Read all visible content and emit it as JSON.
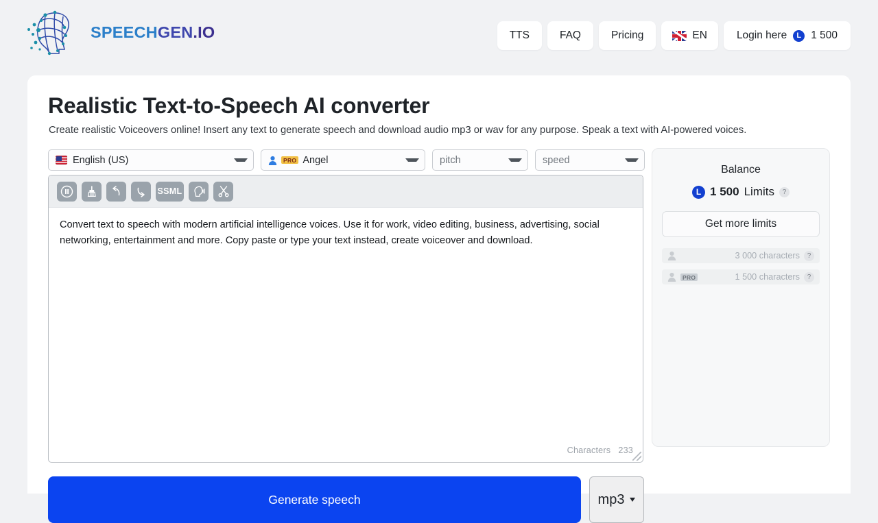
{
  "brand": {
    "name_part1": "SPEECH",
    "name_part2": "GEN",
    "name_part3": ".IO",
    "logo_icon": "network-head-logo"
  },
  "nav": {
    "tts": "TTS",
    "faq": "FAQ",
    "pricing": "Pricing",
    "lang": "EN",
    "lang_flag": "uk-flag-icon",
    "login": "Login here",
    "login_credits": "1 500",
    "credit_symbol": "L"
  },
  "hero": {
    "title": "Realistic Text-to-Speech AI converter",
    "subtitle": "Create realistic Voiceovers online! Insert any text to generate speech and download audio mp3 or wav for any purpose. Speak a text with AI-powered voices."
  },
  "controls": {
    "language": "English (US)",
    "language_flag": "us-flag-icon",
    "voice": "Angel",
    "voice_badge": "PRO",
    "pitch_placeholder": "pitch",
    "speed_placeholder": "speed"
  },
  "toolbar": {
    "buttons": [
      {
        "name": "pause-icon",
        "label": ""
      },
      {
        "name": "clear-broom-icon",
        "label": ""
      },
      {
        "name": "undo-icon",
        "label": ""
      },
      {
        "name": "redo-icon",
        "label": ""
      },
      {
        "name": "ssml-button",
        "label": "SSML"
      },
      {
        "name": "speak-head-icon",
        "label": ""
      },
      {
        "name": "scissors-icon",
        "label": ""
      }
    ],
    "ssml_label": "SSML"
  },
  "editor": {
    "text": "Convert text to speech with modern artificial intelligence voices. Use it for work, video editing, business, advertising, social networking, entertainment and more. Copy paste or type your text instead, create voiceover and download.",
    "characters_label": "Characters",
    "characters_count": "233"
  },
  "actions": {
    "generate": "Generate speech",
    "format": "mp3"
  },
  "balance": {
    "title": "Balance",
    "credit_symbol": "L",
    "amount": "1 500",
    "unit": "Limits",
    "help": "?",
    "get_more": "Get more limits",
    "rows": [
      {
        "icon": "person-icon",
        "badge": "",
        "text": "3 000 characters",
        "help": "?"
      },
      {
        "icon": "person-pro-icon",
        "badge": "PRO",
        "text": "1 500 characters",
        "help": "?"
      }
    ]
  },
  "colors": {
    "page_bg": "#f1f2f4",
    "accent_blue": "#0b44f0",
    "credit_blue": "#1340d0",
    "pro_yellow": "#f2c044",
    "toolbar_gray": "#9aa3ab"
  }
}
